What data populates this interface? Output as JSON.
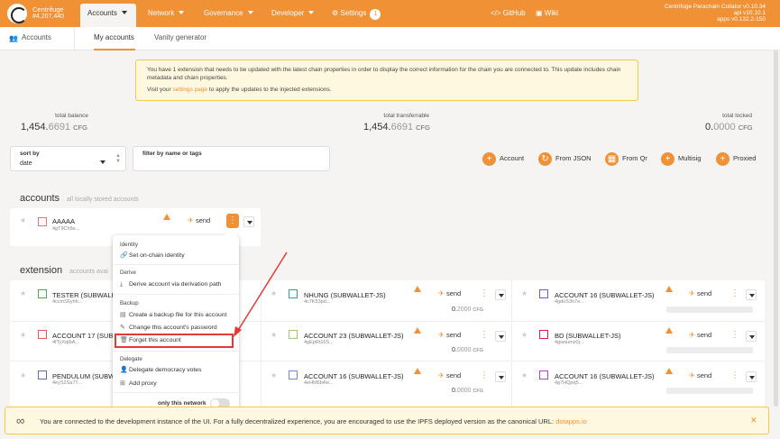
{
  "topbar": {
    "chain_name": "Centrifuge",
    "block": "#4,207,440",
    "nav": [
      {
        "label": "Accounts",
        "active": true
      },
      {
        "label": "Network"
      },
      {
        "label": "Governance"
      },
      {
        "label": "Developer"
      },
      {
        "label": "Settings",
        "badge": "1"
      }
    ],
    "github": "GitHub",
    "wiki": "Wiki",
    "version_lines": [
      "Centrifuge Parachain Collator v0.10.34",
      "api v10.10.1",
      "apps v0.132.2-150"
    ]
  },
  "tabs": {
    "root": "Accounts",
    "items": [
      "My accounts",
      "Vanity generator"
    ]
  },
  "notice": {
    "line1": "You have 1 extension that needs to be updated with the latest chain properties in order to display the correct information for the chain you are connected to. This update includes chain metadata and chain properties.",
    "line2_pre": "Visit your ",
    "line2_link": "settings page",
    "line2_post": " to apply the updates to the injected extensions."
  },
  "summary": {
    "total_balance": {
      "label": "total balance",
      "int": "1,454.",
      "dec": "6691",
      "unit": "CFG"
    },
    "total_transferrable": {
      "label": "total transferrable",
      "int": "1,454.",
      "dec": "6691",
      "unit": "CFG"
    },
    "total_locked": {
      "label": "total locked",
      "int": "0.",
      "dec": "0000",
      "unit": "CFG"
    }
  },
  "filters": {
    "sort_label": "sort by",
    "sort_value": "date",
    "filter_label": "filter by name or tags"
  },
  "actions": [
    "Account",
    "From JSON",
    "From Qr",
    "Multisig",
    "Proxied"
  ],
  "accounts_section": {
    "title": "accounts",
    "subtitle": "all locally stored accounts"
  },
  "local_account": {
    "name": "AAAAA",
    "addr": "4gT9Ch5e..."
  },
  "send_label": "send",
  "extension_section": {
    "title": "extension",
    "subtitle": "accounts avai"
  },
  "ext_accounts": [
    {
      "name": "TESTER (SUBWALL",
      "addr": "4ccmS6yhh..."
    },
    {
      "name": "NHUNG (SUBWALLET-JS)",
      "addr": "4c7K53pd...",
      "bal_int": "0.",
      "bal_dec": "2000",
      "unit": "CFG"
    },
    {
      "name": "ACCOUNT 16 (SUBWALLET-JS)",
      "addr": "4gdoS3h7e..."
    },
    {
      "name": "ACCOUNT 17 (SUBW",
      "addr": "4fTyXqtbA..."
    },
    {
      "name": "ACCOUNT 23 (SUBWALLET-JS)",
      "addr": "4gEpRt16S...",
      "bal_int": "0.",
      "bal_dec": "0000",
      "unit": "CFG"
    },
    {
      "name": "BD (SUBWALLET-JS)",
      "addr": "4gseiumz0j..."
    },
    {
      "name": "PENDULUM (SUBW",
      "addr": "4eyS2Sa7T..."
    },
    {
      "name": "ACCOUNT 16 (SUBWALLET-JS)",
      "addr": "4eHM6b4ie...",
      "bal_int": "0.",
      "bal_dec": "0000",
      "unit": "CFG"
    },
    {
      "name": "ACCOUNT 16 (SUBWALLET-JS)",
      "addr": "4g7HQpq5..."
    }
  ],
  "popup": {
    "identity_header": "Identity",
    "set_identity": "Set on-chain identity",
    "derive_header": "Derive",
    "derive_item": "Derive account via derivation path",
    "backup_header": "Backup",
    "backup_file": "Create a backup file for this account",
    "change_password": "Change this account's password",
    "forget": "Forget this account",
    "delegate_header": "Delegate",
    "delegate_votes": "Delegate democracy votes",
    "add_proxy": "Add proxy",
    "only_network": "only this network"
  },
  "banner": {
    "text": "You are connected to the development instance of the UI. For a fully decentralized experience, you are encouraged to use the IPFS deployed version as the canonical URL: ",
    "link": "dotapps.io"
  },
  "colors": {
    "accent": "#f19135",
    "highlight": "#e53935"
  }
}
